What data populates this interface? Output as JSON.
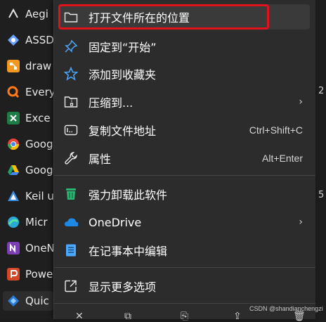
{
  "apps": [
    {
      "name": "Aegi",
      "color": "#e5e5e5"
    },
    {
      "name": "ASSD",
      "color": "#6aa0ff"
    },
    {
      "name": "draw",
      "color": "#f19a1f"
    },
    {
      "name": "Every",
      "color": "#ff7a18"
    },
    {
      "name": "Exce",
      "color": "#1e7d45"
    },
    {
      "name": "Goog",
      "color": "#fbbc05"
    },
    {
      "name": "Goog",
      "color": "#1fa463"
    },
    {
      "name": "Keil u",
      "color": "#3b8be0"
    },
    {
      "name": "Micr",
      "color": "#2aa9d6"
    },
    {
      "name": "OneN",
      "color": "#7b3fb3"
    },
    {
      "name": "Powe",
      "color": "#d24726"
    },
    {
      "name": "Quic",
      "color": "#2c7bd9"
    }
  ],
  "menu": {
    "open_location": "打开文件所在的位置",
    "pin_start": "固定到“开始”",
    "add_favorites": "添加到收藏夹",
    "compress_to": "压缩到...",
    "copy_path": "复制文件地址",
    "copy_path_shortcut": "Ctrl+Shift+C",
    "properties": "属性",
    "properties_shortcut": "Alt+Enter",
    "force_uninstall": "强力卸载此软件",
    "onedrive": "OneDrive",
    "edit_notepad": "在记事本中编辑",
    "more_options": "显示更多选项"
  },
  "edge_chars": [
    "2",
    "5"
  ],
  "watermark": "CSDN @shandianchengzi",
  "colors": {
    "highlight_border": "#e0121c",
    "menu_bg": "#2c2c2c",
    "accent": "#4aa8ff"
  }
}
